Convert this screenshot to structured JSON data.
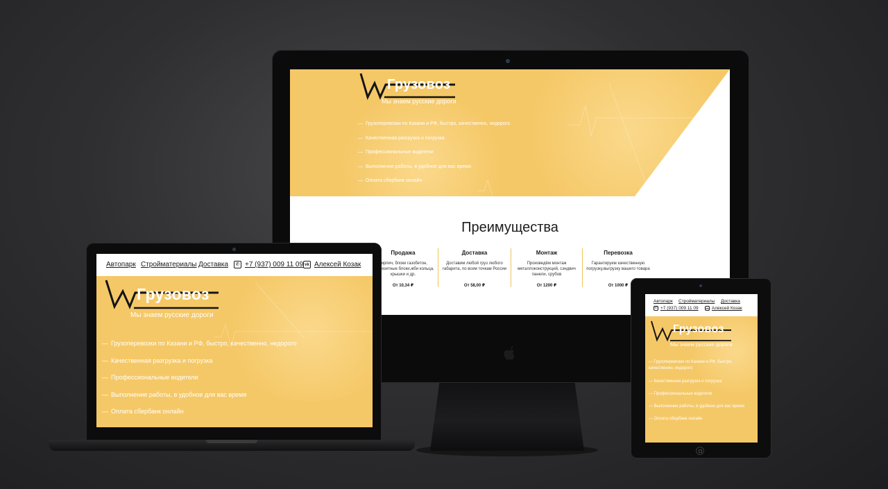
{
  "site": {
    "brand": "Грузовоз",
    "tagline": "Мы знаем русские дороги",
    "features": [
      "Грузоперевозки по Казани и РФ, быстро, качественно, недорого",
      "Качественная разгрузка и погрузка",
      "Профессиональные водители",
      "Выполнение работы, в удобное для вас время",
      "Оплата сбербанк онлайн"
    ],
    "nav": {
      "links": [
        "Автопарк",
        "Стройматериалы",
        "Доставка"
      ],
      "phone": "+7 (937) 009 11 09",
      "vk_contact": "Алексей Козак"
    },
    "advantages": {
      "title": "Преимущества",
      "items": [
        {
          "name": "Продажа",
          "desc": "Кирпич, блоки газобетон, керамзитные блоки,жби кольца, крышки и др.",
          "price": "От 10,34 ₽"
        },
        {
          "name": "Доставка",
          "desc": "Доставим любой груз любого габарита, по всем точкам России",
          "price": "От 58,00 ₽"
        },
        {
          "name": "Монтаж",
          "desc": "Произведём монтаж металлоконструкций, сэндвич панели, срубов",
          "price": "От 1200 ₽"
        },
        {
          "name": "Перевозка",
          "desc": "Гарантируем качественную погрузку,выгрузку вашего товара",
          "price": "От 1000 ₽"
        }
      ]
    }
  },
  "icons": {
    "phone": "phone-icon",
    "vk": "vk-icon",
    "apple": "apple-icon"
  },
  "colors": {
    "accent": "#f5c867",
    "background": "#2f2f31",
    "device": "#0b0b0c",
    "separator": "#f0c35a"
  }
}
